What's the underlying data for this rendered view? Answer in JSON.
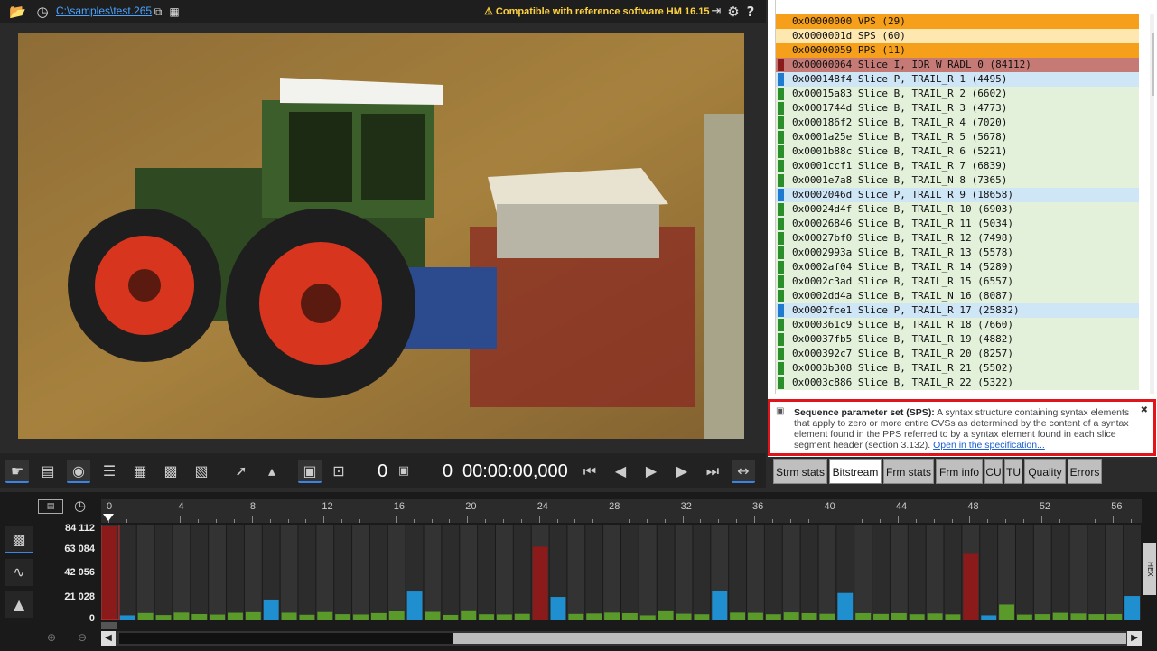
{
  "toolbar": {
    "file_path": "C:\\samples\\test.265",
    "compat_text": "Compatible with reference software HM 16.15"
  },
  "controls": {
    "frame_counter_a": "0",
    "frame_counter_b": "0",
    "timecode": "00:00:00,000"
  },
  "nal_units": [
    {
      "text": "0x00000000 VPS (29)",
      "bg": "#f59f1a",
      "mark": ""
    },
    {
      "text": "0x0000001d SPS (60)",
      "bg": "#ffe7b0",
      "mark": ""
    },
    {
      "text": "0x00000059 PPS (11)",
      "bg": "#f59f1a",
      "mark": ""
    },
    {
      "text": "0x00000064 Slice I, IDR_W_RADL 0 (84112)",
      "bg": "#c67a76",
      "mark": "#8b1a1a"
    },
    {
      "text": "0x000148f4 Slice P, TRAIL_R 1 (4495)",
      "bg": "#cfe6f7",
      "mark": "#1f7bd0"
    },
    {
      "text": "0x00015a83 Slice B, TRAIL_R 2 (6602)",
      "bg": "#e3f0da",
      "mark": "#2a8f2a"
    },
    {
      "text": "0x0001744d Slice B, TRAIL_R 3 (4773)",
      "bg": "#e3f0da",
      "mark": "#2a8f2a"
    },
    {
      "text": "0x000186f2 Slice B, TRAIL_R 4 (7020)",
      "bg": "#e3f0da",
      "mark": "#2a8f2a"
    },
    {
      "text": "0x0001a25e Slice B, TRAIL_R 5 (5678)",
      "bg": "#e3f0da",
      "mark": "#2a8f2a"
    },
    {
      "text": "0x0001b88c Slice B, TRAIL_R 6 (5221)",
      "bg": "#e3f0da",
      "mark": "#2a8f2a"
    },
    {
      "text": "0x0001ccf1 Slice B, TRAIL_R 7 (6839)",
      "bg": "#e3f0da",
      "mark": "#2a8f2a"
    },
    {
      "text": "0x0001e7a8 Slice B, TRAIL_N 8 (7365)",
      "bg": "#e3f0da",
      "mark": "#2a8f2a"
    },
    {
      "text": "0x0002046d Slice P, TRAIL_R 9 (18658)",
      "bg": "#cfe6f7",
      "mark": "#1f7bd0"
    },
    {
      "text": "0x00024d4f Slice B, TRAIL_R 10 (6903)",
      "bg": "#e3f0da",
      "mark": "#2a8f2a"
    },
    {
      "text": "0x00026846 Slice B, TRAIL_R 11 (5034)",
      "bg": "#e3f0da",
      "mark": "#2a8f2a"
    },
    {
      "text": "0x00027bf0 Slice B, TRAIL_R 12 (7498)",
      "bg": "#e3f0da",
      "mark": "#2a8f2a"
    },
    {
      "text": "0x0002993a Slice B, TRAIL_R 13 (5578)",
      "bg": "#e3f0da",
      "mark": "#2a8f2a"
    },
    {
      "text": "0x0002af04 Slice B, TRAIL_R 14 (5289)",
      "bg": "#e3f0da",
      "mark": "#2a8f2a"
    },
    {
      "text": "0x0002c3ad Slice B, TRAIL_R 15 (6557)",
      "bg": "#e3f0da",
      "mark": "#2a8f2a"
    },
    {
      "text": "0x0002dd4a Slice B, TRAIL_N 16 (8087)",
      "bg": "#e3f0da",
      "mark": "#2a8f2a"
    },
    {
      "text": "0x0002fce1 Slice P, TRAIL_R 17 (25832)",
      "bg": "#cfe6f7",
      "mark": "#1f7bd0"
    },
    {
      "text": "0x000361c9 Slice B, TRAIL_R 18 (7660)",
      "bg": "#e3f0da",
      "mark": "#2a8f2a"
    },
    {
      "text": "0x00037fb5 Slice B, TRAIL_R 19 (4882)",
      "bg": "#e3f0da",
      "mark": "#2a8f2a"
    },
    {
      "text": "0x000392c7 Slice B, TRAIL_R 20 (8257)",
      "bg": "#e3f0da",
      "mark": "#2a8f2a"
    },
    {
      "text": "0x0003b308 Slice B, TRAIL_R 21 (5502)",
      "bg": "#e3f0da",
      "mark": "#2a8f2a"
    },
    {
      "text": "0x0003c886 Slice B, TRAIL_R 22 (5322)",
      "bg": "#e3f0da",
      "mark": "#2a8f2a"
    }
  ],
  "description": {
    "title": "Sequence parameter set (SPS):",
    "body": " A syntax structure containing syntax elements that apply to zero or more entire CVSs as determined by the content of a syntax element found in the PPS referred to by a syntax element found in each slice segment header (section 3.132). ",
    "link": "Open in the specification..."
  },
  "tabs": [
    "Strm stats",
    "Bitstream",
    "Frm stats",
    "Frm info",
    "CU",
    "TU",
    "Quality",
    "Errors"
  ],
  "active_tab": 1,
  "hex_label": "HEX",
  "timeline": {
    "axis_labels": [
      "0",
      "4",
      "8",
      "12",
      "16",
      "20",
      "24",
      "28",
      "32",
      "36",
      "40",
      "44",
      "48",
      "52",
      "56"
    ],
    "y_labels": [
      "84 112",
      "63 084",
      "42 056",
      "21 028",
      "0"
    ]
  },
  "chart_data": {
    "type": "bar",
    "ylim": [
      0,
      84112
    ],
    "x": [
      0,
      1,
      2,
      3,
      4,
      5,
      6,
      7,
      8,
      9,
      10,
      11,
      12,
      13,
      14,
      15,
      16,
      17,
      18,
      19,
      20,
      21,
      22,
      23,
      24,
      25,
      26,
      27,
      28,
      29,
      30,
      31,
      32,
      33,
      34,
      35,
      36,
      37,
      38,
      39,
      40,
      41,
      42,
      43,
      44,
      45,
      46,
      47,
      48,
      49,
      50,
      51,
      52,
      53,
      54,
      55,
      56,
      57
    ],
    "values": [
      84112,
      4495,
      6602,
      4773,
      7020,
      5678,
      5221,
      6839,
      7365,
      18658,
      6903,
      5034,
      7498,
      5578,
      5289,
      6557,
      8087,
      25832,
      7660,
      4882,
      8257,
      5502,
      5322,
      5900,
      66000,
      21000,
      5800,
      6200,
      7000,
      6500,
      4500,
      8200,
      6000,
      5500,
      26500,
      7000,
      6800,
      5500,
      7200,
      6500,
      5900,
      24500,
      6500,
      5800,
      6500,
      5500,
      6200,
      5400,
      59500,
      4500,
      14200,
      5200,
      5600,
      6800,
      6200,
      5600,
      5700,
      21800
    ],
    "colors": [
      "#8b1a1a",
      "#1f8fcf",
      "#5a9a2a",
      "#5a9a2a",
      "#5a9a2a",
      "#5a9a2a",
      "#5a9a2a",
      "#5a9a2a",
      "#5a9a2a",
      "#1f8fcf",
      "#5a9a2a",
      "#5a9a2a",
      "#5a9a2a",
      "#5a9a2a",
      "#5a9a2a",
      "#5a9a2a",
      "#5a9a2a",
      "#1f8fcf",
      "#5a9a2a",
      "#5a9a2a",
      "#5a9a2a",
      "#5a9a2a",
      "#5a9a2a",
      "#5a9a2a",
      "#8b1a1a",
      "#1f8fcf",
      "#5a9a2a",
      "#5a9a2a",
      "#5a9a2a",
      "#5a9a2a",
      "#5a9a2a",
      "#5a9a2a",
      "#5a9a2a",
      "#5a9a2a",
      "#1f8fcf",
      "#5a9a2a",
      "#5a9a2a",
      "#5a9a2a",
      "#5a9a2a",
      "#5a9a2a",
      "#5a9a2a",
      "#1f8fcf",
      "#5a9a2a",
      "#5a9a2a",
      "#5a9a2a",
      "#5a9a2a",
      "#5a9a2a",
      "#5a9a2a",
      "#8b1a1a",
      "#1f8fcf",
      "#5a9a2a",
      "#5a9a2a",
      "#5a9a2a",
      "#5a9a2a",
      "#5a9a2a",
      "#5a9a2a",
      "#5a9a2a",
      "#1f8fcf"
    ]
  }
}
